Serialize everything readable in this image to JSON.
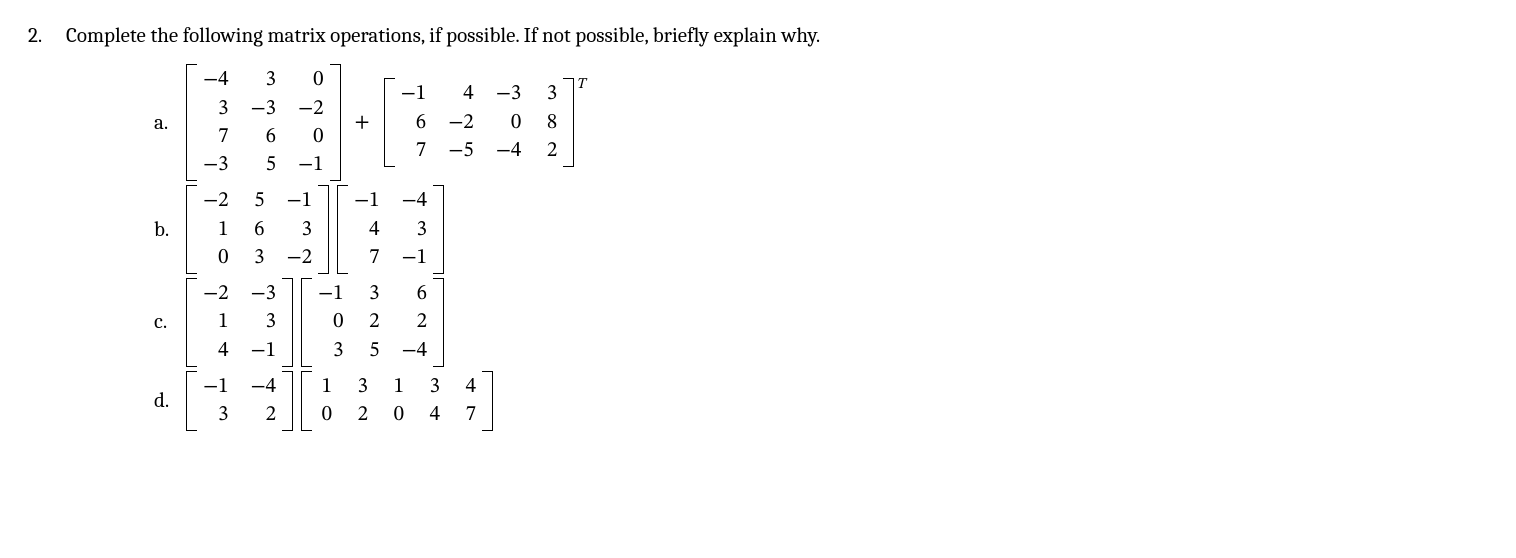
{
  "problem": {
    "number": "2.",
    "prompt": "Complete the following matrix operations, if possible. If not possible, briefly explain why.",
    "parts": [
      {
        "label": "a.",
        "expr": [
          {
            "type": "matrix",
            "rows": 4,
            "cols": 3,
            "data": [
              [
                "−4",
                "3",
                "0"
              ],
              [
                "3",
                "−3",
                "−2"
              ],
              [
                "7",
                "6",
                "0"
              ],
              [
                "−3",
                "5",
                "−1"
              ]
            ]
          },
          {
            "type": "op",
            "value": "+"
          },
          {
            "type": "matrix",
            "rows": 3,
            "cols": 4,
            "transpose": "T",
            "data": [
              [
                "−1",
                "4",
                "−3",
                "3"
              ],
              [
                "6",
                "−2",
                "0",
                "8"
              ],
              [
                "7",
                "−5",
                "−4",
                "2"
              ]
            ]
          }
        ]
      },
      {
        "label": "b.",
        "expr": [
          {
            "type": "matrix",
            "rows": 3,
            "cols": 3,
            "data": [
              [
                "−2",
                "5",
                "−1"
              ],
              [
                "1",
                "6",
                "3"
              ],
              [
                "0",
                "3",
                "−2"
              ]
            ]
          },
          {
            "type": "matrix",
            "rows": 3,
            "cols": 2,
            "data": [
              [
                "−1",
                "−4"
              ],
              [
                "4",
                "3"
              ],
              [
                "7",
                "−1"
              ]
            ]
          }
        ]
      },
      {
        "label": "c.",
        "expr": [
          {
            "type": "matrix",
            "rows": 3,
            "cols": 2,
            "data": [
              [
                "−2",
                "−3"
              ],
              [
                "1",
                "3"
              ],
              [
                "4",
                "−1"
              ]
            ]
          },
          {
            "type": "matrix",
            "rows": 3,
            "cols": 3,
            "data": [
              [
                "−1",
                "3",
                "6"
              ],
              [
                "0",
                "2",
                "2"
              ],
              [
                "3",
                "5",
                "−4"
              ]
            ]
          }
        ]
      },
      {
        "label": "d.",
        "expr": [
          {
            "type": "matrix",
            "rows": 2,
            "cols": 2,
            "data": [
              [
                "−1",
                "−4"
              ],
              [
                "3",
                "2"
              ]
            ]
          },
          {
            "type": "matrix",
            "rows": 2,
            "cols": 5,
            "data": [
              [
                "1",
                "3",
                "1",
                "3",
                "4"
              ],
              [
                "0",
                "2",
                "0",
                "4",
                "7"
              ]
            ]
          }
        ]
      }
    ]
  }
}
